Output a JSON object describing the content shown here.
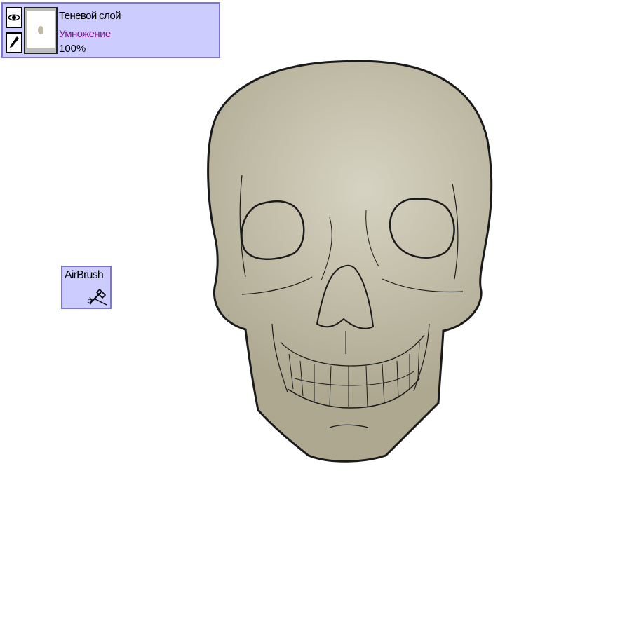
{
  "layer": {
    "name": "Теневой слой",
    "blend_mode": "Умножение",
    "opacity": "100%",
    "visible_icon": "eye-icon",
    "edit_icon": "pencil-icon"
  },
  "tool": {
    "name": "AirBrush",
    "icon": "airbrush-icon"
  },
  "colors": {
    "panel_bg": "#ccccff",
    "panel_border": "#7b74d9",
    "blend_mode_text": "#7a1a8c",
    "skull_fill_light": "#d3d0bf",
    "skull_fill_dark": "#b3ad96",
    "line": "#1a1a1a"
  }
}
